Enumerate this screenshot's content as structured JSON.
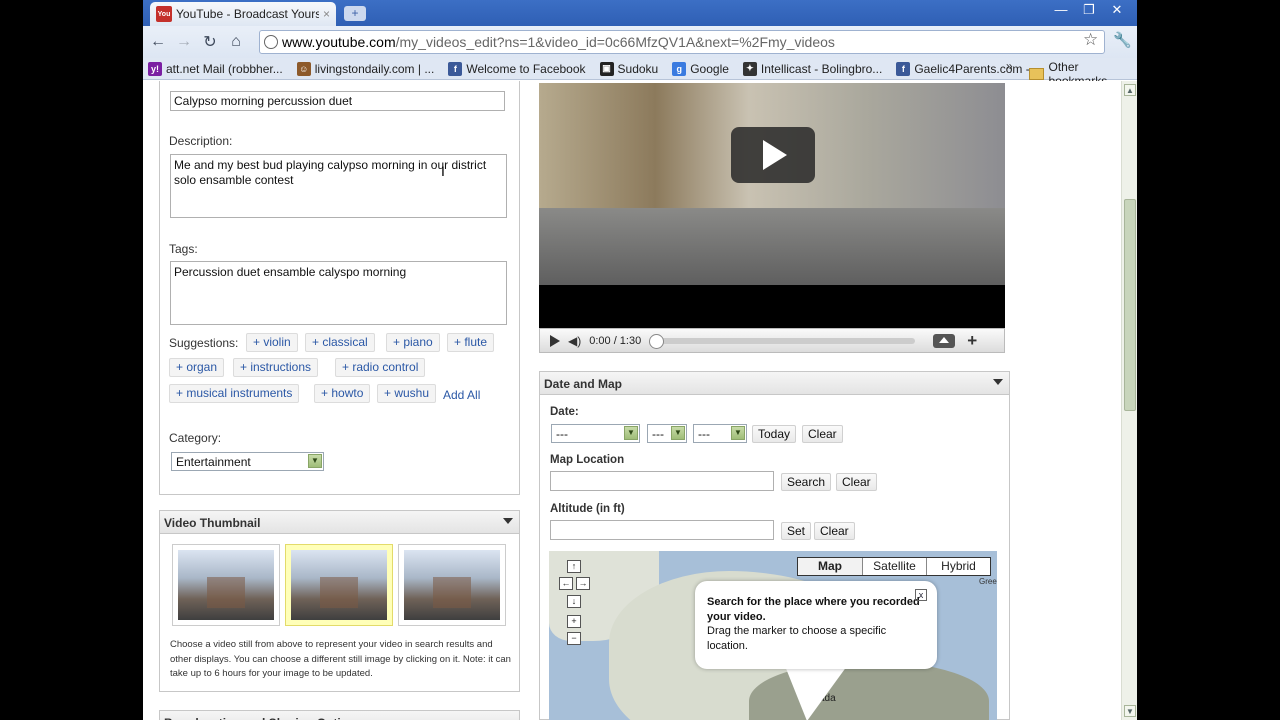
{
  "browser": {
    "tab_title": "YouTube - Broadcast Yours...",
    "tab_favicon": "You",
    "tab_close": "×",
    "new_tab": "+",
    "url_host": "www.youtube.com",
    "url_rest": "/my_videos_edit?ns=1&video_id=0c66MfzQV1A&next=%2Fmy_videos",
    "window_buttons": [
      "—",
      "❐",
      "✕"
    ],
    "nav": {
      "back": "←",
      "forward": "→",
      "reload": "↻",
      "home": "⌂"
    },
    "star": "☆",
    "wrench": "🔧",
    "bookmarks": [
      {
        "label": "att.net Mail (robbher...",
        "icon_text": "y!",
        "color": "#7b1fa2"
      },
      {
        "label": "livingstondaily.com | ...",
        "icon_text": "☺",
        "color": "#8d5a2b"
      },
      {
        "label": "Welcome to Facebook",
        "icon_text": "f",
        "color": "#3b5998"
      },
      {
        "label": "Sudoku",
        "icon_text": "▣",
        "color": "#222"
      },
      {
        "label": "Google",
        "icon_text": "g",
        "color": "#3a7be0"
      },
      {
        "label": "Intellicast - Bolingbro...",
        "icon_text": "✦",
        "color": "#333"
      },
      {
        "label": "Gaelic4Parents.com - ...",
        "icon_text": "f",
        "color": "#3b5998"
      }
    ],
    "bookmarks_more": "»",
    "other_bookmarks": "Other bookmarks"
  },
  "form": {
    "title_value": "Calypso morning percussion duet",
    "description_label": "Description:",
    "description_value": "Me and my best bud playing calypso morning in our district solo ensamble contest",
    "tags_label": "Tags:",
    "tags_value": "Percussion duet ensamble calyspo morning",
    "suggestions_label": "Suggestions:",
    "suggestions": [
      "+ violin",
      "+ classical",
      "+ piano",
      "+ flute",
      "+ organ",
      "+ instructions",
      "+ radio control",
      "+ musical instruments",
      "+ howto",
      "+ wushu"
    ],
    "add_all": "Add All",
    "category_label": "Category:",
    "category_value": "Entertainment"
  },
  "thumbnail": {
    "header": "Video Thumbnail",
    "note": "Choose a video still from above to represent your video in search results and other displays. You can choose a different still image by clicking on it. Note: it can take up to 6 hours for your image to be updated."
  },
  "player": {
    "time": "0:00 / 1:30"
  },
  "date_map": {
    "header": "Date and Map",
    "date_label": "Date:",
    "date_month": "---",
    "date_day": "---",
    "date_year": "---",
    "today_button": "Today",
    "clear_button": "Clear",
    "map_location_label": "Map Location",
    "search_button": "Search",
    "altitude_label": "Altitude (in ft)",
    "set_button": "Set",
    "map_types": [
      "Map",
      "Satellite",
      "Hybrid"
    ],
    "map_labels": {
      "greenland": "Gree",
      "canada": "ada"
    },
    "bubble_bold": "Search for the place where you recorded your video.",
    "bubble_text": "Drag the marker to choose a specific location.",
    "bubble_close": "x"
  },
  "bottom_header": "Broadcasting and Sharing Options"
}
